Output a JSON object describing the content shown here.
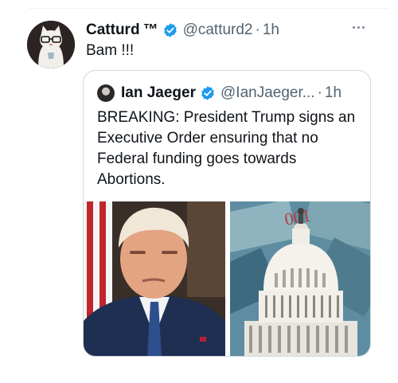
{
  "tweet": {
    "author_name": "Catturd",
    "author_tm": "™",
    "author_handle": "@catturd2",
    "separator": "·",
    "time": "1h",
    "text": "Bam !!!"
  },
  "quoted_tweet": {
    "author_name": "Ian Jaeger",
    "author_handle": "@IanJaeger...",
    "separator": "·",
    "time": "1h",
    "text": "BREAKING: President Trump signs an Executive Order ensuring that no Federal funding goes towards Abortions."
  },
  "media": [
    {
      "description": "portrait-photo"
    },
    {
      "description": "capitol-money-photo"
    }
  ],
  "colors": {
    "verified_blue": "#1d9bf0",
    "secondary_text": "#536471",
    "border": "#cfd9de"
  }
}
